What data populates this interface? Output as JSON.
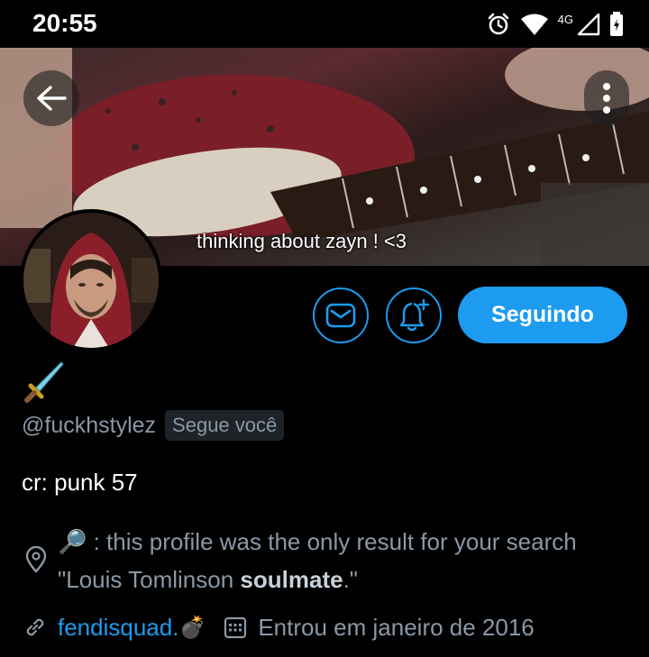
{
  "status_bar": {
    "time": "20:55",
    "network_label": "4G",
    "icons": [
      "alarm-icon",
      "wifi-icon",
      "signal-icon",
      "battery-icon"
    ]
  },
  "header": {
    "banner_caption": "thinking about zayn ! <3",
    "back_icon": "arrow-left-icon",
    "more_icon": "more-vertical-icon"
  },
  "actions": {
    "message_icon": "envelope-icon",
    "notify_icon": "bell-plus-icon",
    "follow_label": "Seguindo"
  },
  "profile": {
    "emoji": "🗡️",
    "handle": "@fuckhstylez",
    "follows_you": "Segue você",
    "bio": "cr: punk 57",
    "location_emoji": "🔎",
    "location_prefix": " : this profile was the only result for your search \"Louis Tomlinson ",
    "location_bold": "soulmate",
    "location_suffix": ".\"",
    "website": "fendisquad.",
    "website_emoji": "💣",
    "joined": "Entrou em janeiro de 2016"
  },
  "colors": {
    "accent": "#1d9bf0",
    "muted_text": "#8b98a5",
    "background": "#000000"
  }
}
